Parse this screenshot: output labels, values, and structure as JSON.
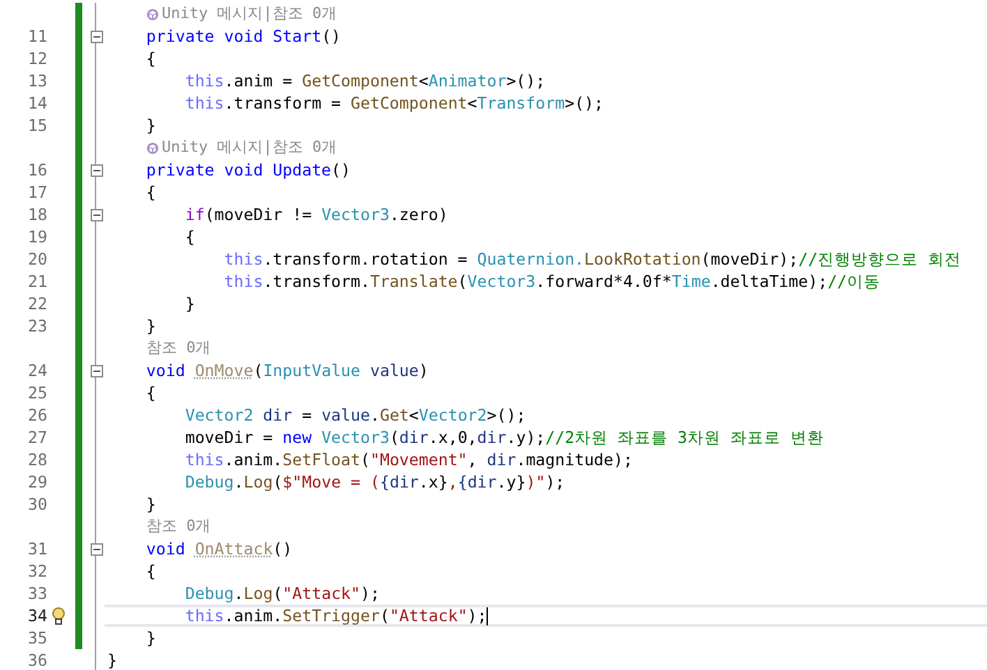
{
  "lines": [
    {
      "kind": "annotation",
      "unity_icon": true,
      "changed": true,
      "text": "Unity 메시지|참조 0개"
    },
    {
      "kind": "code",
      "number": "11",
      "changed": true,
      "fold": true,
      "current": false,
      "lightbulb": false,
      "tokens": [
        {
          "kind": "kw",
          "text": "    private void Start"
        },
        {
          "kind": "plain",
          "text": "()"
        }
      ]
    },
    {
      "kind": "code",
      "number": "12",
      "changed": true,
      "fold": false,
      "current": false,
      "lightbulb": false,
      "tokens": [
        {
          "kind": "plain",
          "text": "    {"
        }
      ]
    },
    {
      "kind": "code",
      "number": "13",
      "changed": true,
      "fold": false,
      "current": false,
      "lightbulb": false,
      "tokens": [
        {
          "kind": "this",
          "text": "        this"
        },
        {
          "kind": "plain",
          "text": ".anim = "
        },
        {
          "kind": "method",
          "text": "GetComponent"
        },
        {
          "kind": "plain",
          "text": "<"
        },
        {
          "kind": "type",
          "text": "Animator"
        },
        {
          "kind": "plain",
          "text": ">();"
        }
      ]
    },
    {
      "kind": "code",
      "number": "14",
      "changed": true,
      "fold": false,
      "current": false,
      "lightbulb": false,
      "tokens": [
        {
          "kind": "this",
          "text": "        this"
        },
        {
          "kind": "plain",
          "text": ".transform = "
        },
        {
          "kind": "method",
          "text": "GetComponent"
        },
        {
          "kind": "plain",
          "text": "<"
        },
        {
          "kind": "type",
          "text": "Transform"
        },
        {
          "kind": "plain",
          "text": ">();"
        }
      ]
    },
    {
      "kind": "code",
      "number": "15",
      "changed": true,
      "fold": false,
      "current": false,
      "lightbulb": false,
      "tokens": [
        {
          "kind": "plain",
          "text": "    }"
        }
      ]
    },
    {
      "kind": "annotation",
      "unity_icon": true,
      "changed": true,
      "text": "Unity 메시지|참조 0개"
    },
    {
      "kind": "code",
      "number": "16",
      "changed": true,
      "fold": true,
      "current": false,
      "lightbulb": false,
      "tokens": [
        {
          "kind": "kw",
          "text": "    private void Update"
        },
        {
          "kind": "plain",
          "text": "()"
        }
      ]
    },
    {
      "kind": "code",
      "number": "17",
      "changed": true,
      "fold": false,
      "current": false,
      "lightbulb": false,
      "tokens": [
        {
          "kind": "plain",
          "text": "    {"
        }
      ]
    },
    {
      "kind": "code",
      "number": "18",
      "changed": true,
      "fold": true,
      "current": false,
      "lightbulb": false,
      "tokens": [
        {
          "kind": "ctrl",
          "text": "        if"
        },
        {
          "kind": "plain",
          "text": "(moveDir != "
        },
        {
          "kind": "type",
          "text": "Vector3"
        },
        {
          "kind": "plain",
          "text": ".zero)"
        }
      ]
    },
    {
      "kind": "code",
      "number": "19",
      "changed": true,
      "fold": false,
      "current": false,
      "lightbulb": false,
      "tokens": [
        {
          "kind": "plain",
          "text": "        {"
        }
      ]
    },
    {
      "kind": "code",
      "number": "20",
      "changed": true,
      "fold": false,
      "current": false,
      "lightbulb": false,
      "tokens": [
        {
          "kind": "this",
          "text": "            this"
        },
        {
          "kind": "plain",
          "text": ".transform.rotation = "
        },
        {
          "kind": "type",
          "text": "Quaternion."
        },
        {
          "kind": "method",
          "text": "LookRotation"
        },
        {
          "kind": "plain",
          "text": "(moveDir);"
        },
        {
          "kind": "comment",
          "text": "//진행방향으로 회전"
        }
      ]
    },
    {
      "kind": "code",
      "number": "21",
      "changed": true,
      "fold": false,
      "current": false,
      "lightbulb": false,
      "tokens": [
        {
          "kind": "this",
          "text": "            this"
        },
        {
          "kind": "plain",
          "text": ".transform."
        },
        {
          "kind": "method",
          "text": "Translate"
        },
        {
          "kind": "plain",
          "text": "("
        },
        {
          "kind": "type",
          "text": "Vector3"
        },
        {
          "kind": "plain",
          "text": ".forward*4.0f*"
        },
        {
          "kind": "type",
          "text": "Time"
        },
        {
          "kind": "plain",
          "text": ".deltaTime);"
        },
        {
          "kind": "comment",
          "text": "//이동"
        }
      ]
    },
    {
      "kind": "code",
      "number": "22",
      "changed": true,
      "fold": false,
      "current": false,
      "lightbulb": false,
      "tokens": [
        {
          "kind": "plain",
          "text": "        }"
        }
      ]
    },
    {
      "kind": "code",
      "number": "23",
      "changed": true,
      "fold": false,
      "current": false,
      "lightbulb": false,
      "tokens": [
        {
          "kind": "plain",
          "text": "    }"
        }
      ]
    },
    {
      "kind": "annotation",
      "unity_icon": false,
      "changed": true,
      "text": "참조 0개"
    },
    {
      "kind": "code",
      "number": "24",
      "changed": true,
      "fold": true,
      "current": false,
      "lightbulb": false,
      "tokens": [
        {
          "kind": "kw",
          "text": "    void "
        },
        {
          "kind": "unused",
          "text": "OnMove"
        },
        {
          "kind": "plain",
          "text": "("
        },
        {
          "kind": "type",
          "text": "InputValue"
        },
        {
          "kind": "param",
          "text": " value"
        },
        {
          "kind": "plain",
          "text": ")"
        }
      ]
    },
    {
      "kind": "code",
      "number": "25",
      "changed": true,
      "fold": false,
      "current": false,
      "lightbulb": false,
      "tokens": [
        {
          "kind": "plain",
          "text": "    {"
        }
      ]
    },
    {
      "kind": "code",
      "number": "26",
      "changed": true,
      "fold": false,
      "current": false,
      "lightbulb": false,
      "tokens": [
        {
          "kind": "type",
          "text": "        Vector2"
        },
        {
          "kind": "param",
          "text": " dir"
        },
        {
          "kind": "plain",
          "text": " = "
        },
        {
          "kind": "param",
          "text": "value"
        },
        {
          "kind": "plain",
          "text": "."
        },
        {
          "kind": "method",
          "text": "Get"
        },
        {
          "kind": "plain",
          "text": "<"
        },
        {
          "kind": "type",
          "text": "Vector2"
        },
        {
          "kind": "plain",
          "text": ">();"
        }
      ]
    },
    {
      "kind": "code",
      "number": "27",
      "changed": true,
      "fold": false,
      "current": false,
      "lightbulb": false,
      "tokens": [
        {
          "kind": "plain",
          "text": "        moveDir = "
        },
        {
          "kind": "kw",
          "text": "new "
        },
        {
          "kind": "type",
          "text": "Vector3"
        },
        {
          "kind": "plain",
          "text": "("
        },
        {
          "kind": "param",
          "text": "dir"
        },
        {
          "kind": "plain",
          "text": ".x,0,"
        },
        {
          "kind": "param",
          "text": "dir"
        },
        {
          "kind": "plain",
          "text": ".y);"
        },
        {
          "kind": "comment",
          "text": "//2차원 좌표를 3차원 좌표로 변환"
        }
      ]
    },
    {
      "kind": "code",
      "number": "28",
      "changed": true,
      "fold": false,
      "current": false,
      "lightbulb": false,
      "tokens": [
        {
          "kind": "this",
          "text": "        this"
        },
        {
          "kind": "plain",
          "text": ".anim."
        },
        {
          "kind": "method",
          "text": "SetFloat"
        },
        {
          "kind": "plain",
          "text": "("
        },
        {
          "kind": "string",
          "text": "\"Movement\""
        },
        {
          "kind": "plain",
          "text": ", "
        },
        {
          "kind": "param",
          "text": "dir"
        },
        {
          "kind": "plain",
          "text": ".magnitude);"
        }
      ]
    },
    {
      "kind": "code",
      "number": "29",
      "changed": true,
      "fold": false,
      "current": false,
      "lightbulb": false,
      "tokens": [
        {
          "kind": "type",
          "text": "        Debug"
        },
        {
          "kind": "plain",
          "text": "."
        },
        {
          "kind": "method",
          "text": "Log"
        },
        {
          "kind": "plain",
          "text": "("
        },
        {
          "kind": "string",
          "text": "$\"Move = ("
        },
        {
          "kind": "param",
          "text": "{dir"
        },
        {
          "kind": "plain",
          "text": ".x}"
        },
        {
          "kind": "string",
          "text": ","
        },
        {
          "kind": "param",
          "text": "{dir"
        },
        {
          "kind": "plain",
          "text": ".y}"
        },
        {
          "kind": "string",
          "text": ")\""
        },
        {
          "kind": "plain",
          "text": ");"
        }
      ]
    },
    {
      "kind": "code",
      "number": "30",
      "changed": true,
      "fold": false,
      "current": false,
      "lightbulb": false,
      "tokens": [
        {
          "kind": "plain",
          "text": "    }"
        }
      ]
    },
    {
      "kind": "annotation",
      "unity_icon": false,
      "changed": true,
      "text": "참조 0개"
    },
    {
      "kind": "code",
      "number": "31",
      "changed": true,
      "fold": true,
      "current": false,
      "lightbulb": false,
      "tokens": [
        {
          "kind": "kw",
          "text": "    void "
        },
        {
          "kind": "unused",
          "text": "OnAttack"
        },
        {
          "kind": "plain",
          "text": "()"
        }
      ]
    },
    {
      "kind": "code",
      "number": "32",
      "changed": true,
      "fold": false,
      "current": false,
      "lightbulb": false,
      "tokens": [
        {
          "kind": "plain",
          "text": "    {"
        }
      ]
    },
    {
      "kind": "code",
      "number": "33",
      "changed": true,
      "fold": false,
      "current": false,
      "lightbulb": false,
      "tokens": [
        {
          "kind": "type",
          "text": "        Debug"
        },
        {
          "kind": "plain",
          "text": "."
        },
        {
          "kind": "method",
          "text": "Log"
        },
        {
          "kind": "plain",
          "text": "("
        },
        {
          "kind": "string",
          "text": "\"Attack\""
        },
        {
          "kind": "plain",
          "text": ");"
        }
      ]
    },
    {
      "kind": "code",
      "number": "34",
      "changed": true,
      "fold": false,
      "current": true,
      "lightbulb": true,
      "tokens": [
        {
          "kind": "this",
          "text": "        this"
        },
        {
          "kind": "plain",
          "text": ".anim."
        },
        {
          "kind": "method",
          "text": "SetTrigger"
        },
        {
          "kind": "plain",
          "text": "("
        },
        {
          "kind": "string",
          "text": "\"Attack\""
        },
        {
          "kind": "plain",
          "text": ");"
        }
      ]
    },
    {
      "kind": "code",
      "number": "35",
      "changed": true,
      "fold": false,
      "current": false,
      "lightbulb": false,
      "tokens": [
        {
          "kind": "plain",
          "text": "    }"
        }
      ]
    },
    {
      "kind": "code",
      "number": "36",
      "changed": false,
      "fold": false,
      "current": false,
      "lightbulb": false,
      "tokens": [
        {
          "kind": "plain",
          "text": "}"
        }
      ]
    }
  ]
}
